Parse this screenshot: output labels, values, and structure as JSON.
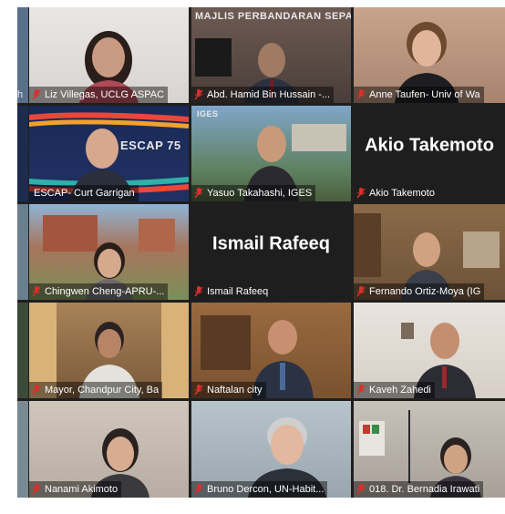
{
  "meeting": {
    "participants": [
      {
        "name": "Liz Villegas, UCLG ASPAC"
      },
      {
        "name": "Abd. Hamid Bin Hussain -...",
        "background_text": "MAJLIS PERBANDARAN SEPA"
      },
      {
        "name": "Anne Taufen- Univ of Wa"
      },
      {
        "name": "ESCAP- Curt Garrigan",
        "background_text": "ESCAP 75",
        "active_speaker": true
      },
      {
        "name": "Yasuo Takahashi, IGES",
        "background_text": "IGES"
      },
      {
        "name": "Akio Takemoto",
        "display_name": "Akio Takemoto",
        "video_off": true
      },
      {
        "name": "Chingwen Cheng-APRU-..."
      },
      {
        "name": "Ismail Rafeeq",
        "display_name": "Ismail Rafeeq",
        "video_off": true
      },
      {
        "name": "Fernando Ortiz-Moya (IG"
      },
      {
        "name": "Mayor, Chandpur City, Ba"
      },
      {
        "name": "Naftalan city"
      },
      {
        "name": "Kaveh Zahedi"
      },
      {
        "name": "Nanami Akimoto"
      },
      {
        "name": "Bruno Dercon, UN-Habit..."
      },
      {
        "name": "018. Dr. Bernadia Irawati"
      }
    ],
    "left_edge_labels": [
      "h"
    ],
    "colors": {
      "muted_mic": "#d9302c",
      "active_border": "#c8e03a",
      "name_text": "#ffffff",
      "tile_gap": "#1f1f1f"
    }
  }
}
